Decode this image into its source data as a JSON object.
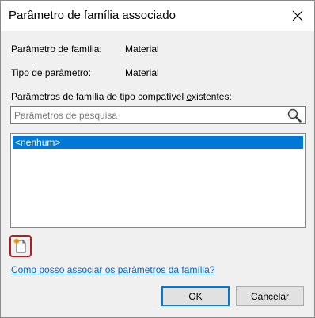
{
  "window": {
    "title": "Parâmetro de família associado",
    "close_icon": "close-icon"
  },
  "fields": {
    "family_param_label": "Parâmetro de família:",
    "family_param_value": "Material",
    "param_type_label": "Tipo de parâmetro:",
    "param_type_value": "Material"
  },
  "section": {
    "label_prefix": "Parâmetros de família de tipo compatível ",
    "label_underlined": "e",
    "label_suffix": "xistentes:"
  },
  "search": {
    "placeholder": "Parâmetros de pesquisa",
    "value": "",
    "icon": "magnifier-icon"
  },
  "list": {
    "items": [
      {
        "label": "<nenhum>",
        "selected": true
      }
    ]
  },
  "toolbar": {
    "new_parameter_icon": "new-parameter-icon"
  },
  "help": {
    "link_text": "Como posso associar os parâmetros da família?"
  },
  "buttons": {
    "ok_label": "OK",
    "cancel_label": "Cancelar"
  },
  "colors": {
    "selection": "#0078d7",
    "link": "#0066cc",
    "highlight_border": "#b01e23"
  }
}
